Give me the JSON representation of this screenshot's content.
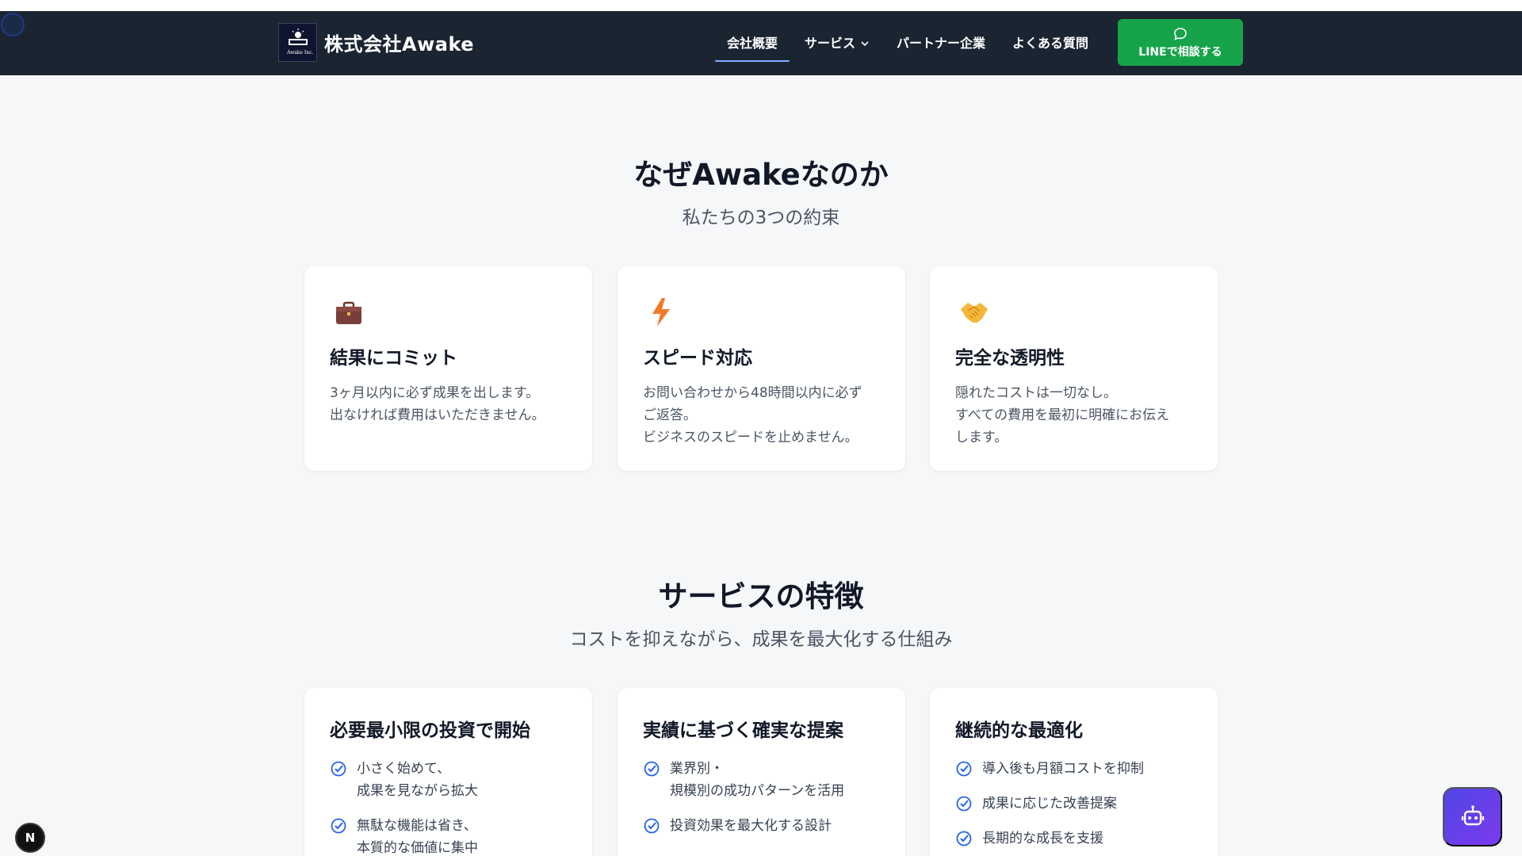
{
  "brand": {
    "name": "株式会社Awake",
    "logo_text": "Awake Inc."
  },
  "nav": {
    "items": [
      {
        "label": "会社概要"
      },
      {
        "label": "サービス"
      },
      {
        "label": "パートナー企業"
      },
      {
        "label": "よくある質問"
      }
    ],
    "active_index": 0,
    "cta_label": "LINEで相談する",
    "cta_icon": "chat-bubble-icon"
  },
  "why": {
    "title": "なぜAwakeなのか",
    "subtitle": "私たちの3つの約束",
    "cards": [
      {
        "icon": "briefcase-icon",
        "title": "結果にコミット",
        "lines": [
          "3ヶ月以内に必ず成果を出します。",
          "出なければ費用はいただきません。"
        ]
      },
      {
        "icon": "lightning-icon",
        "title": "スピード対応",
        "lines": [
          "お問い合わせから48時間以内に必ず",
          "ご返答。",
          "ビジネスのスピードを止めません。"
        ]
      },
      {
        "icon": "handshake-icon",
        "title": "完全な透明性",
        "lines": [
          "隠れたコストは一切なし。",
          "すべての費用を最初に明確にお伝え",
          "します。"
        ]
      }
    ]
  },
  "features": {
    "title": "サービスの特徴",
    "subtitle": "コストを抑えながら、成果を最大化する仕組み",
    "cards": [
      {
        "title": "必要最小限の投資で開始",
        "items": [
          [
            "小さく始めて、",
            "成果を見ながら拡大"
          ],
          [
            "無駄な機能は省き、",
            "本質的な価値に集中"
          ]
        ]
      },
      {
        "title": "実績に基づく確実な提案",
        "items": [
          [
            "業界別・",
            "規模別の成功パターンを活用"
          ],
          [
            "投資効果を最大化する設計"
          ]
        ]
      },
      {
        "title": "継続的な最適化",
        "items": [
          [
            "導入後も月額コストを抑制"
          ],
          [
            "成果に応じた改善提案"
          ],
          [
            "長期的な成長を支援"
          ]
        ]
      }
    ]
  },
  "floating": {
    "badge": "N",
    "chat_icon": "robot-icon"
  },
  "colors": {
    "navbar": "#1b2431",
    "cta": "#17a34a",
    "accent": "#7fb0ff",
    "check": "#2563eb"
  }
}
